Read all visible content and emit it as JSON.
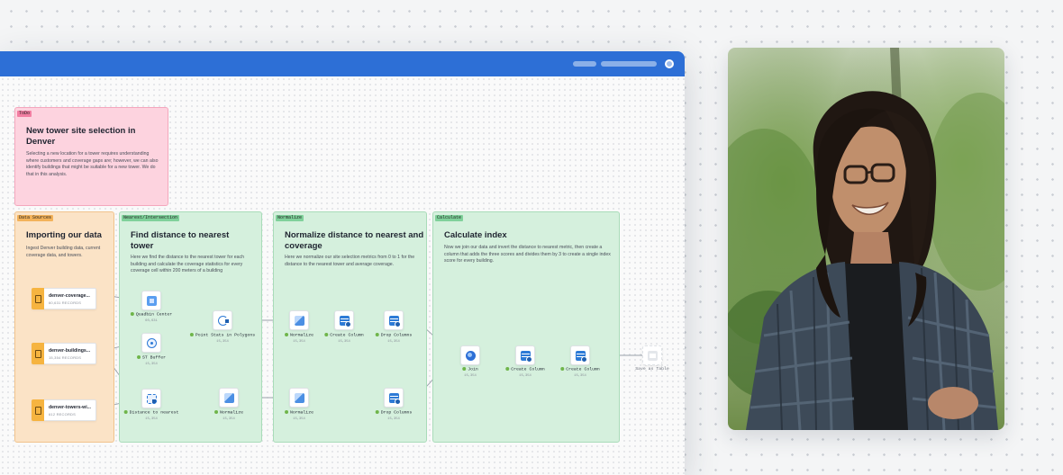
{
  "groups": {
    "todo": {
      "tag": "ToDo",
      "title": "New tower site selection in Denver",
      "desc": "Selecting a new location for a tower requires understanding where customers and coverage gaps are; however, we can also identify buildings that might be suitable for a new tower. We do that in this analysis."
    },
    "data_sources": {
      "tag": "Data Sources",
      "title": "Importing our data",
      "desc": "Ingest Denver building data, current coverage data, and towers."
    },
    "nearest": {
      "tag": "Nearest/Intersection",
      "title": "Find distance to nearest tower",
      "desc": "Here we find the distance to the nearest tower for each building and calculate the coverage statistics for every coverage cell within 200 meters of a building"
    },
    "normalize": {
      "tag": "Normalize",
      "title": "Normalize distance to nearest and coverage",
      "desc": "Here we normalize our site selection metrics from 0 to 1 for the distance to the nearest tower and average coverage."
    },
    "calculate": {
      "tag": "Calculate",
      "title": "Calculate index",
      "desc": "Now we join our data and invert the distance to nearest metric, then create a column that adds the three scores and divides them by 3 to create a single index score for every building."
    }
  },
  "sources": [
    {
      "name": "denver-coverage...",
      "count": "60,631 RECORDS"
    },
    {
      "name": "denver-buildings...",
      "count": "15,354 RECORDS"
    },
    {
      "name": "denver-towers-wi...",
      "count": "612 RECORDS"
    }
  ],
  "nodes": {
    "quadbin_center": {
      "label": "Quadbin Center",
      "count": "60,631",
      "icon": "quadbin-icon"
    },
    "st_buffer": {
      "label": "ST Buffer",
      "count": "15,354",
      "icon": "buffer-icon"
    },
    "distance_nearest": {
      "label": "Distance to nearest",
      "count": "15,354",
      "icon": "distance-icon"
    },
    "point_stats": {
      "label": "Point Stats in Polygons",
      "count": "15,354",
      "icon": "point-stats-icon"
    },
    "normalize_nearest": {
      "label": "Normalize",
      "count": "15,354",
      "icon": "normalize-icon"
    },
    "normalize_a": {
      "label": "Normalize",
      "count": "15,354",
      "icon": "normalize-icon"
    },
    "create_col_a": {
      "label": "Create Column",
      "count": "15,354",
      "icon": "create-column-icon"
    },
    "drop_col_a": {
      "label": "Drop Columns",
      "count": "15,354",
      "icon": "drop-columns-icon"
    },
    "normalize_b": {
      "label": "Normalize",
      "count": "15,354",
      "icon": "normalize-icon"
    },
    "drop_col_b": {
      "label": "Drop Columns",
      "count": "15,354",
      "icon": "drop-columns-icon"
    },
    "join": {
      "label": "Join",
      "count": "15,354",
      "icon": "join-icon"
    },
    "create_col_b": {
      "label": "Create Column",
      "count": "15,354",
      "icon": "create-column-icon"
    },
    "create_col_c": {
      "label": "Create Column",
      "count": "15,354",
      "icon": "create-column-icon"
    },
    "save_table": {
      "label": "Save as Table",
      "icon": "save-table-icon"
    }
  },
  "colors": {
    "titlebar": "#2d6fd6",
    "todo_bg": "#fdd3df",
    "sources_bg": "#fbe3c6",
    "step_bg": "#d5f0dd",
    "source_icon": "#f6b440",
    "node_ok": "#6fb54a"
  },
  "photo": {
    "subject": "smiling person with long dark hair in plaid shirt, forest background"
  }
}
